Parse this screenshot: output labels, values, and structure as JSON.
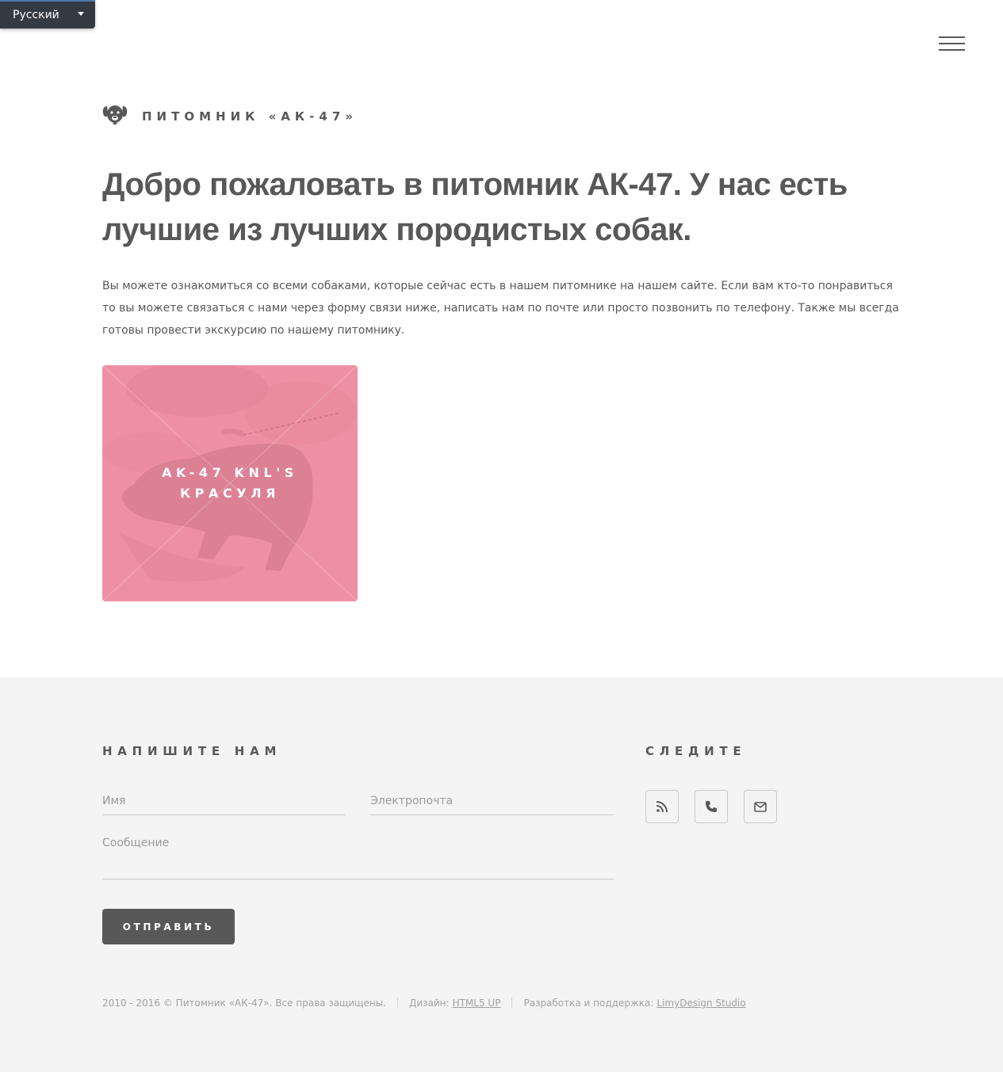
{
  "language": {
    "selected": "Русский",
    "icon": "caret-down-icon"
  },
  "header": {
    "menu_icon": "hamburger-menu-icon"
  },
  "logo": {
    "icon": "dog-icon",
    "text": "Питомник «АК-47»"
  },
  "hero": {
    "headline": "Добро пожаловать в питомник АК-47. У нас есть лучшие из лучших породистых собак.",
    "intro": "Вы можете ознакомиться со всеми собаками, которые сейчас есть в нашем питомнике на нашем сайте. Если вам кто-то понравиться то вы можете связаться с нами через форму связи ниже, написать нам по почте или просто позвонить по телефону. Также мы всегда готовы провести экскурсию по нашему питомнику."
  },
  "tiles": [
    {
      "title": "AK-47 Knl's Красуля",
      "overlay_color": "#f2849e"
    }
  ],
  "footer": {
    "contact": {
      "title": "Напишите нам",
      "name_placeholder": "Имя",
      "email_placeholder": "Электропочта",
      "message_placeholder": "Сообщение",
      "submit_label": "Отправить"
    },
    "follow": {
      "title": "Следите",
      "icons": [
        "rss-icon",
        "phone-icon",
        "envelope-icon"
      ]
    },
    "copyright": {
      "text": "2010 - 2016 © Питомник «АК-47». Все права защищены.",
      "design_label": "Дизайн:",
      "design_link": "HTML5 UP",
      "dev_label": "Разработка и поддержка:",
      "dev_link": "LimyDesign Studio"
    }
  }
}
